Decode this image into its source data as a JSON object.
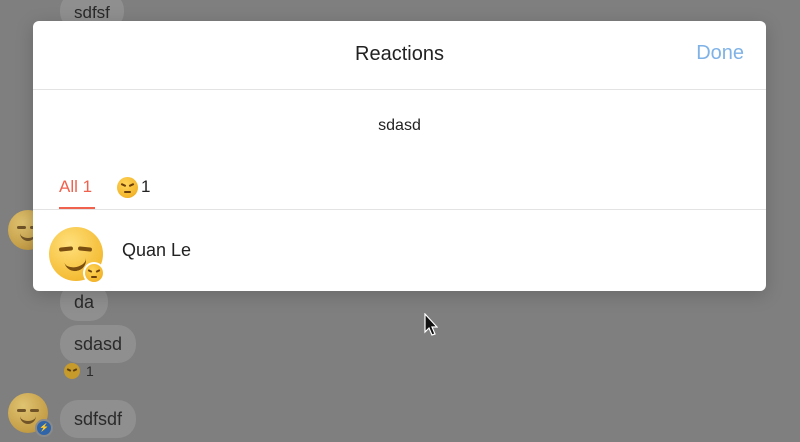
{
  "modal": {
    "title": "Reactions",
    "done_label": "Done",
    "message_text": "sdasd",
    "tabs": [
      {
        "label": "All 1",
        "active": true
      },
      {
        "emoji": "angry-emoji",
        "count": "1",
        "active": false
      }
    ],
    "reactors": [
      {
        "name": "Quan Le",
        "avatar": "smirk-emoji-avatar",
        "reaction": "angry-emoji"
      }
    ]
  },
  "background_chat": {
    "messages": [
      {
        "text": "sdfsf"
      },
      {
        "text": "da"
      },
      {
        "text": "sdasd"
      },
      {
        "text": "sdfsdf"
      }
    ],
    "reaction_summary": {
      "emoji": "angry-emoji",
      "count": "1"
    }
  },
  "colors": {
    "accent_blue": "#7fb2e6",
    "active_tab_red": "#f0624d",
    "overlay": "#7f7f7f"
  }
}
